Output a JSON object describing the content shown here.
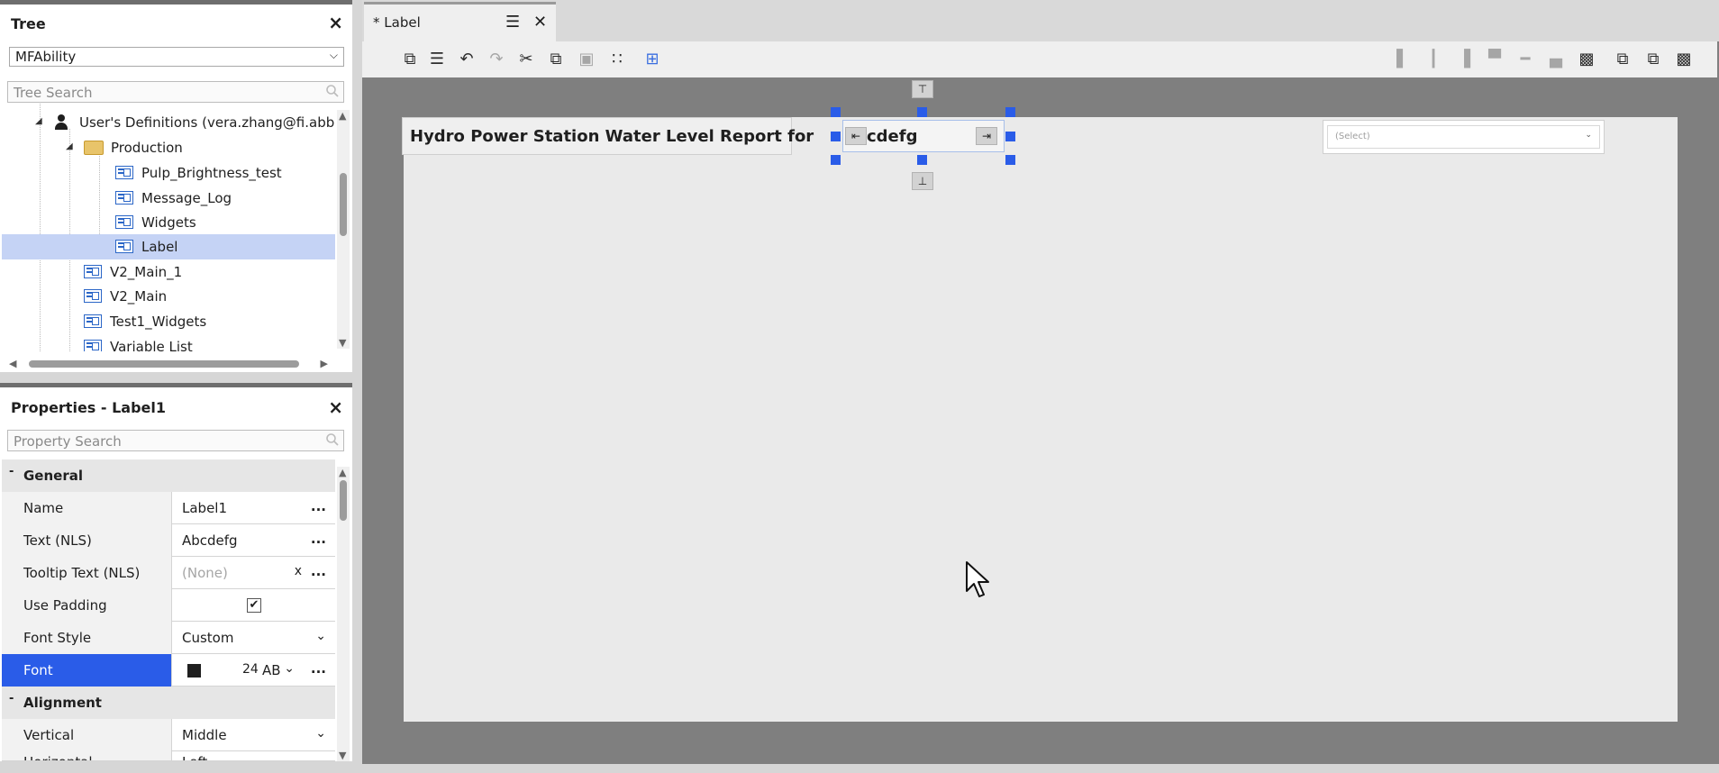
{
  "tree": {
    "title": "Tree",
    "close_icon": "×",
    "dropdown_value": "MFAbility",
    "search_placeholder": "Tree Search",
    "items": [
      {
        "label": "User's Definitions (vera.zhang@fi.abb.co",
        "icon": "user-icon"
      },
      {
        "label": "Production",
        "icon": "folder-icon"
      },
      {
        "label": "Pulp_Brightness_test",
        "icon": "display-icon"
      },
      {
        "label": "Message_Log",
        "icon": "display-icon"
      },
      {
        "label": "Widgets",
        "icon": "display-icon"
      },
      {
        "label": "Label",
        "icon": "display-icon",
        "selected": true
      },
      {
        "label": "V2_Main_1",
        "icon": "display-icon"
      },
      {
        "label": "V2_Main",
        "icon": "display-icon"
      },
      {
        "label": "Test1_Widgets",
        "icon": "display-icon"
      },
      {
        "label": "Variable List",
        "icon": "display-icon"
      }
    ]
  },
  "properties": {
    "title": "Properties - Label1",
    "close_icon": "×",
    "search_placeholder": "Property Search",
    "sections": {
      "general": "General",
      "alignment": "Alignment"
    },
    "rows": {
      "name": {
        "label": "Name",
        "value": "Label1"
      },
      "text": {
        "label": "Text (NLS)",
        "value": "Abcdefg"
      },
      "tooltip": {
        "label": "Tooltip Text (NLS)",
        "value": "(None)",
        "clear": "x"
      },
      "padding": {
        "label": "Use Padding",
        "checked": true
      },
      "font_style": {
        "label": "Font Style",
        "value": "Custom"
      },
      "font": {
        "label": "Font",
        "size": "24",
        "abbrev": "AB"
      },
      "vertical": {
        "label": "Vertical",
        "value": "Middle"
      },
      "horizontal": {
        "label": "Horizontal",
        "value": "Left"
      }
    },
    "ellipsis": "..."
  },
  "editor": {
    "tab_label": "* Label",
    "canvas_label_text": "Hydro Power Station Water Level Report for",
    "selected_label_text": "cdefg",
    "select_placeholder": "(Select)"
  },
  "colors": {
    "accent": "#2a5ce8",
    "selection_bg": "#c5d3f5",
    "canvas_bg": "#eaeaea",
    "editor_bg": "#7f7f7f"
  }
}
